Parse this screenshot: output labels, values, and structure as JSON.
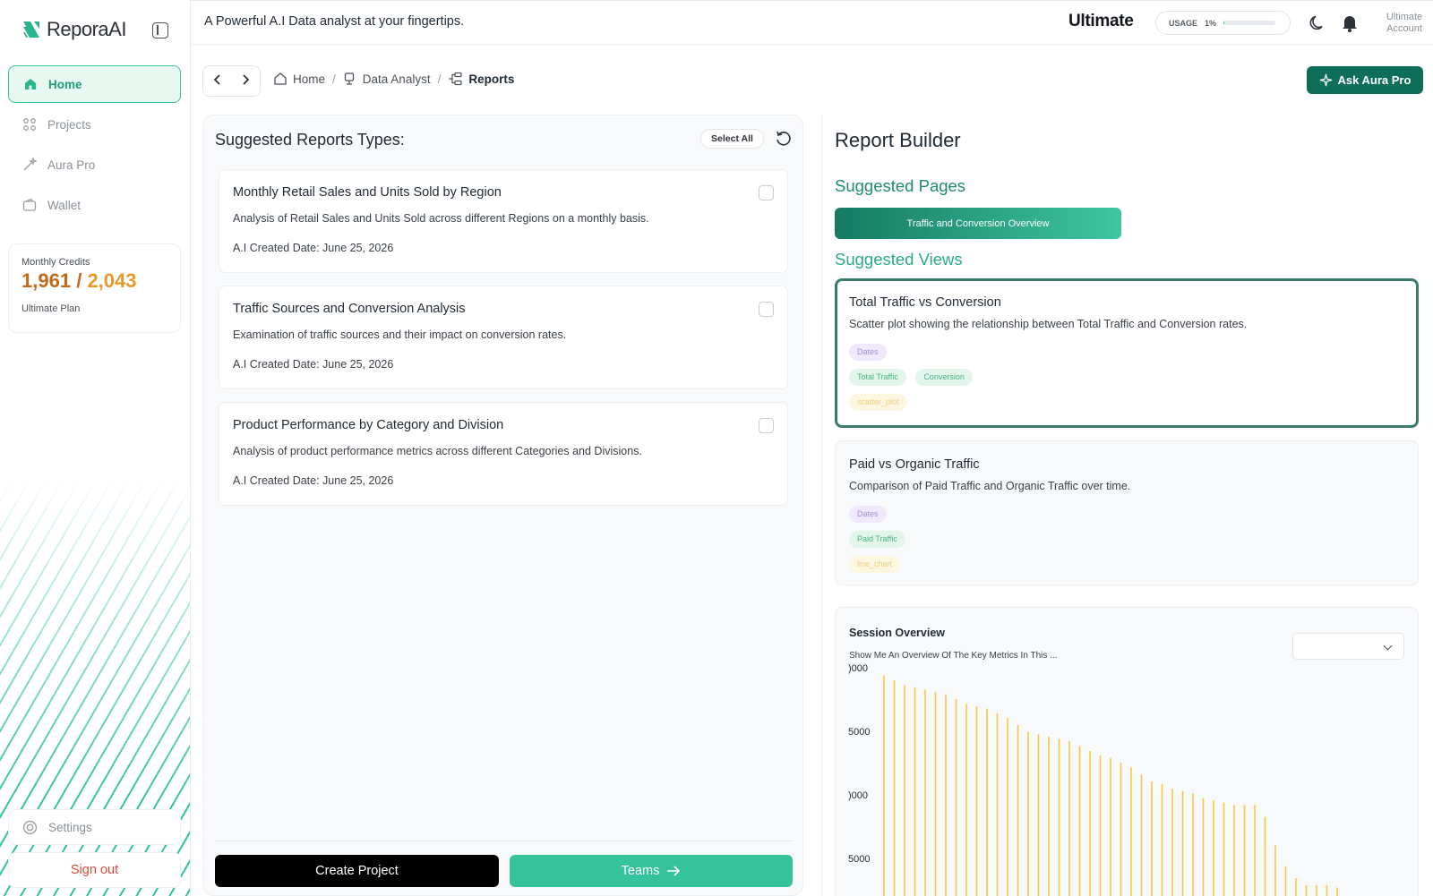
{
  "sidebar": {
    "logo_text": "ReporaAI",
    "nav": [
      {
        "label": "Home",
        "icon": "home-icon",
        "active": true
      },
      {
        "label": "Projects",
        "icon": "projects-icon",
        "active": false
      },
      {
        "label": "Aura Pro",
        "icon": "magic-wand-icon",
        "active": false
      },
      {
        "label": "Wallet",
        "icon": "wallet-icon",
        "active": false
      }
    ],
    "credits": {
      "label": "Monthly Credits",
      "used": "1,961",
      "separator": "/",
      "total": "2,043",
      "plan": "Ultimate Plan"
    },
    "settings_label": "Settings",
    "signout_label": "Sign out"
  },
  "topbar": {
    "tagline": "A Powerful A.I Data analyst at your fingertips.",
    "plan": "Ultimate",
    "usage_label": "USAGE",
    "usage_value": "1%",
    "usage_fraction": 0.01,
    "account_line1": "Ultimate",
    "account_line2": "Account"
  },
  "breadcrumb": [
    {
      "label": "Home",
      "icon": "home-icon"
    },
    {
      "label": "Data Analyst",
      "icon": "monitor-icon"
    },
    {
      "label": "Reports",
      "icon": "hierarchy-icon"
    }
  ],
  "ask_button": "Ask Aura Pro",
  "suggested_reports": {
    "title": "Suggested Reports Types:",
    "select_all": "Select All",
    "items": [
      {
        "title": "Monthly Retail Sales and Units Sold by Region",
        "description": "Analysis of Retail Sales and Units Sold across different Regions on a monthly basis.",
        "date": "A.I Created Date: June 25, 2026"
      },
      {
        "title": "Traffic Sources and Conversion Analysis",
        "description": "Examination of traffic sources and their impact on conversion rates.",
        "date": "A.I Created Date: June 25, 2026"
      },
      {
        "title": "Product Performance by Category and Division",
        "description": "Analysis of product performance metrics across different Categories and Divisions.",
        "date": "A.I Created Date: June 25, 2026"
      }
    ],
    "create_button": "Create Project",
    "teams_button": "Teams"
  },
  "report_builder": {
    "title": "Report Builder",
    "suggested_pages_title": "Suggested Pages",
    "page_pill": "Traffic and Conversion Overview",
    "suggested_views_title": "Suggested Views",
    "views": [
      {
        "title": "Total Traffic vs Conversion",
        "description": "Scatter plot showing the relationship between Total Traffic and Conversion rates.",
        "dim_tag": "Dates",
        "measure_tags": [
          "Total Traffic",
          "Conversion"
        ],
        "type_tag": "scatter_plot"
      },
      {
        "title": "Paid vs Organic Traffic",
        "description": "Comparison of Paid Traffic and Organic Traffic over time.",
        "dim_tag": "Dates",
        "measure_tags": [
          "Paid Traffic"
        ],
        "type_tag": "line_chart"
      }
    ],
    "session": {
      "title": "Session Overview",
      "subtitle": "Show Me An Overview Of The Key Metrics In This ...",
      "dropdown_value": ""
    }
  },
  "colors": {
    "accent": "#2bc49e",
    "primary_dark": "#0f6e59",
    "bar": "#f5c842"
  },
  "chart_data": {
    "type": "bar",
    "title": "",
    "ytick_labels": [
      ")000",
      "5000",
      ")000",
      "5000"
    ],
    "ylim": [
      0,
      1
    ],
    "values": [
      0.94,
      0.92,
      0.9,
      0.89,
      0.88,
      0.87,
      0.86,
      0.84,
      0.82,
      0.81,
      0.8,
      0.78,
      0.76,
      0.73,
      0.7,
      0.69,
      0.68,
      0.67,
      0.66,
      0.64,
      0.62,
      0.6,
      0.59,
      0.57,
      0.55,
      0.52,
      0.49,
      0.48,
      0.46,
      0.45,
      0.44,
      0.42,
      0.41,
      0.4,
      0.39,
      0.39,
      0.39,
      0.34,
      0.22,
      0.13,
      0.08,
      0.05,
      0.05,
      0.05,
      0.04
    ]
  }
}
